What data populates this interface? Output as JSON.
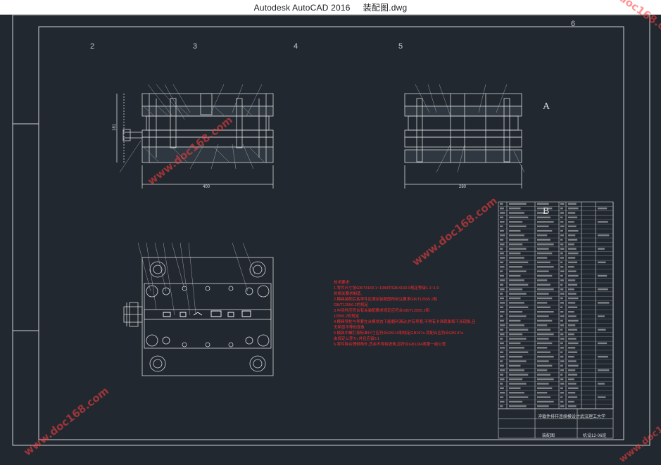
{
  "window": {
    "app_name": "Autodesk AutoCAD 2016",
    "file_name": "装配图.dwg"
  },
  "grid_labels": [
    "2",
    "3",
    "4",
    "5",
    "6"
  ],
  "view_labels": {
    "a": "A",
    "b": "B"
  },
  "dimensions": {
    "front_height": "181",
    "front_width": "400",
    "side_width": "280"
  },
  "tech_requirements": [
    "技术要求:",
    "1.零件尺寸按GB/T4169.1~1984中GB/4169.9规定等级1.1~1.9",
    "的相关要求制造.",
    "2.模具装配后各零件应满足装配图所标注要求GB/T12555.2和",
    "GB/T12556.2的规定",
    "3.中间件应符合有关装配要求规定应符合GB/T12555.2和",
    "12556.2的规定",
    "4.模具导柱与导套在合模状态下能顺利滑动,并有导套,不得有卡滞现象和干涉现象,且",
    "无明显不等的现象",
    "5.模具中螺钉按标准尺寸应符合GB119和规定GB197a 其配合应符合GB197a",
    "由规定公差Tn,并且应留0.1",
    "6.零件除合理倒角外,其余不得有锐角,应符合GB1184表第一级公差"
  ],
  "title_block": {
    "school": "武汉理工大学",
    "design_title": "冲裁件排样连续模设计",
    "drawing_name": "装配图",
    "drawing_no": "机设12-06班"
  },
  "watermark": "www.doc168.com",
  "colors": {
    "background": "#212830",
    "line": "#d8d8d8",
    "annotation": "#ff2a2a",
    "watermark": "#ff4040"
  }
}
